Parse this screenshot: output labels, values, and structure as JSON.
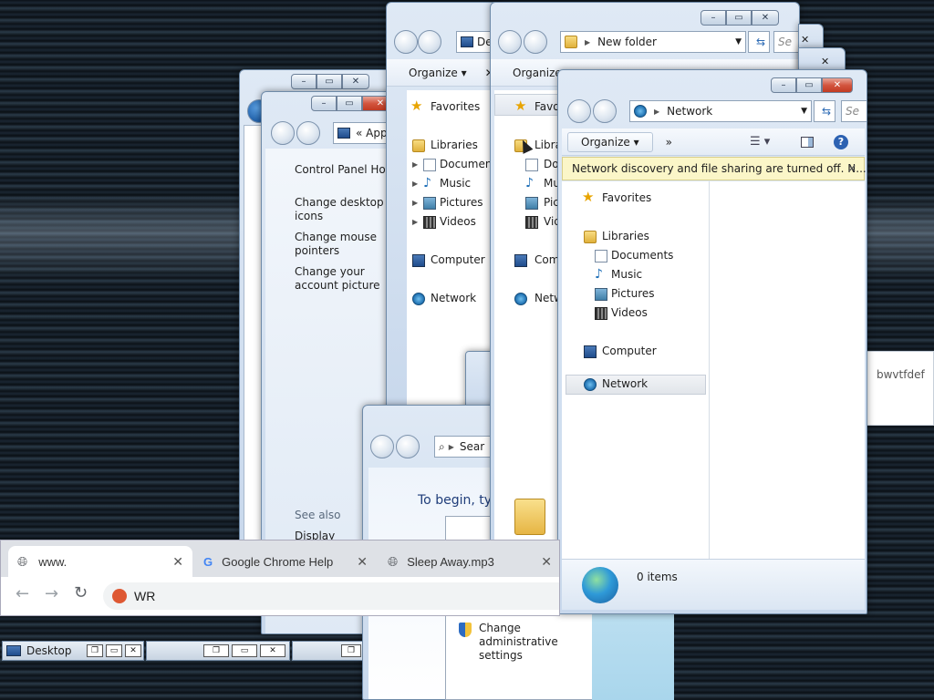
{
  "window_back_left": {
    "buttons": {
      "min": "–",
      "max": "▭",
      "close": "✕"
    }
  },
  "personalize_window": {
    "address": "« App...",
    "links": [
      "Control Panel Home",
      "Change desktop icons",
      "Change mouse pointers",
      "Change your account picture"
    ],
    "see_also": "See also",
    "see_also_link": "Display"
  },
  "explorer1": {
    "address": "De",
    "organize": "Organize ▾",
    "nav": {
      "favorites": "Favorites",
      "libraries": "Libraries",
      "documents": "Document",
      "music": "Music",
      "pictures": "Pictures",
      "videos": "Videos",
      "computer": "Computer",
      "network": "Network"
    }
  },
  "explorer2": {
    "address": "New folder",
    "search": "Se",
    "organize": "Organize",
    "nav": {
      "favorites": "Favo",
      "libraries": "Libra",
      "documents": "Do",
      "music": "Mu",
      "pictures": "Pic",
      "videos": "Vid",
      "computer": "Com",
      "network": "Netw"
    }
  },
  "search_window": {
    "address": "Sear",
    "begin": "To begin, ty"
  },
  "uac_item": {
    "label": "Change administrative settings"
  },
  "right_panel": {
    "text": "bwvtfdef"
  },
  "network_window": {
    "address": "Network",
    "search": "Se",
    "organize": "Organize ▾",
    "more": "»",
    "notice": "Network discovery and file sharing are turned off. N...",
    "nav": {
      "favorites": "Favorites",
      "libraries": "Libraries",
      "documents": "Documents",
      "music": "Music",
      "pictures": "Pictures",
      "videos": "Videos",
      "computer": "Computer",
      "network": "Network"
    },
    "status": "0 items"
  },
  "chrome": {
    "tabs": [
      {
        "title": "www."
      },
      {
        "title": "Google Chrome Help"
      },
      {
        "title": "Sleep Away.mp3"
      }
    ],
    "omnibox": "WR"
  },
  "taskbar": {
    "desktop": "Desktop"
  }
}
